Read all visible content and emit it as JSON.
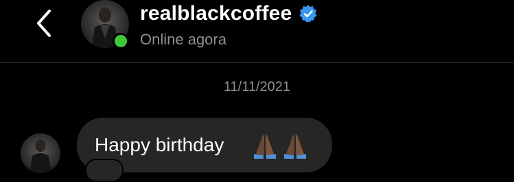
{
  "header": {
    "username": "realblackcoffee",
    "status": "Online agora",
    "verified": true,
    "online_color": "#3fc83a",
    "verified_color": "#3897f0"
  },
  "thread": {
    "date": "11/11/2021",
    "messages": [
      {
        "text": "Happy birthday",
        "emoji": [
          "folded-hands",
          "folded-hands"
        ]
      }
    ]
  },
  "colors": {
    "background": "#000000",
    "bubble": "#262626",
    "muted_text": "#8e8e93",
    "divider": "#262626"
  }
}
